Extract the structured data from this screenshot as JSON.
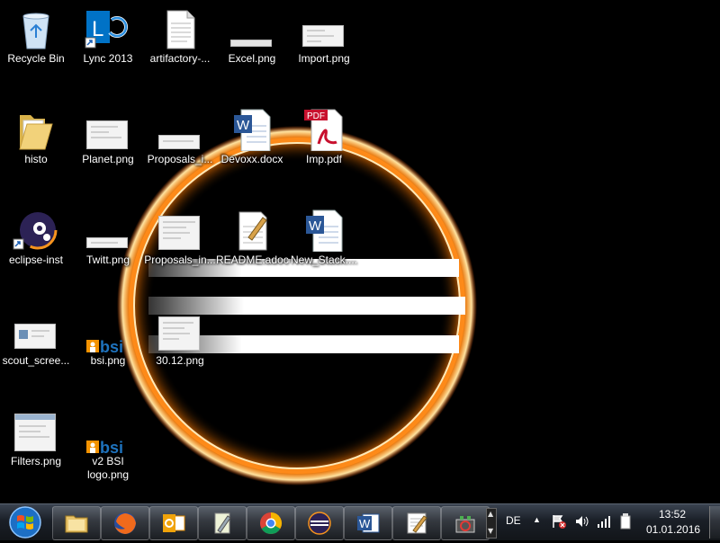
{
  "desktop": {
    "icons": [
      {
        "label": "Recycle Bin",
        "icon": "recycle-bin-icon"
      },
      {
        "label": "Lync 2013",
        "icon": "lync-icon"
      },
      {
        "label": "artifactory-...",
        "icon": "text-file-icon"
      },
      {
        "label": "Excel.png",
        "icon": "image-thumbnail-icon"
      },
      {
        "label": "Import.png",
        "icon": "image-thumbnail-icon"
      },
      {
        "label": "histo",
        "icon": "folder-icon"
      },
      {
        "label": "Planet.png",
        "icon": "image-thumbnail-icon"
      },
      {
        "label": "Proposals_i...",
        "icon": "image-thumbnail-icon"
      },
      {
        "label": "Devoxx.docx",
        "icon": "word-document-icon"
      },
      {
        "label": "Imp.pdf",
        "icon": "pdf-icon"
      },
      {
        "label": "eclipse-inst",
        "icon": "eclipse-installer-icon"
      },
      {
        "label": "Twitt.png",
        "icon": "image-thumbnail-icon"
      },
      {
        "label": "Proposals_in...",
        "icon": "image-thumbnail-icon"
      },
      {
        "label": "README.adoc",
        "icon": "notepad-document-icon"
      },
      {
        "label": "New_Stack....",
        "icon": "word-document-icon"
      },
      {
        "label": "scout_scree...",
        "icon": "image-thumbnail-icon"
      },
      {
        "label": "bsi.png",
        "icon": "bsi-logo-icon"
      },
      {
        "label": "30.12.png",
        "icon": "image-thumbnail-icon"
      },
      {
        "label": "Filters.png",
        "icon": "image-thumbnail-icon"
      },
      {
        "label": "v2 BSI logo.png",
        "icon": "bsi-logo-icon"
      }
    ],
    "bsi_text": "bsi",
    "pdf_text": "PDF",
    "lync_letter": "L"
  },
  "taskbar": {
    "start_icon": "windows-start-icon",
    "pinned": [
      {
        "name": "explorer",
        "icon": "folder-explorer-icon"
      },
      {
        "name": "firefox",
        "icon": "firefox-icon"
      },
      {
        "name": "outlook",
        "icon": "outlook-icon"
      },
      {
        "name": "notepad-plus",
        "icon": "pen-tool-icon"
      },
      {
        "name": "chrome",
        "icon": "chrome-icon"
      },
      {
        "name": "eclipse",
        "icon": "eclipse-icon"
      },
      {
        "name": "word",
        "icon": "word-icon"
      },
      {
        "name": "editor",
        "icon": "text-editor-icon"
      },
      {
        "name": "plugin-tool",
        "icon": "plugin-icon"
      }
    ],
    "language": "DE",
    "time": "13:52",
    "date": "01.01.2016"
  },
  "colors": {
    "ring_outer": "#ff6a00",
    "ring_inner": "#ffd27a",
    "word_blue": "#2b5797",
    "pdf_red": "#c8102e",
    "bsi_blue": "#1e73be",
    "bsi_orange": "#f39200"
  }
}
